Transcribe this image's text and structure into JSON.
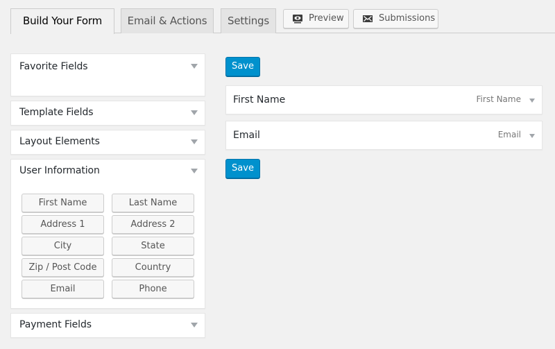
{
  "tabs": [
    {
      "label": "Build Your Form",
      "active": true
    },
    {
      "label": "Email & Actions",
      "active": false
    },
    {
      "label": "Settings",
      "active": false
    }
  ],
  "header_buttons": {
    "preview": {
      "label": "Preview",
      "icon": "preview-icon"
    },
    "submissions": {
      "label": "Submissions",
      "icon": "envelope-icon"
    }
  },
  "sidebar": {
    "panels": [
      {
        "title": "Favorite Fields",
        "expanded": false
      },
      {
        "title": "Template Fields",
        "expanded": false
      },
      {
        "title": "Layout Elements",
        "expanded": false
      },
      {
        "title": "User Information",
        "expanded": true,
        "fields": [
          "First Name",
          "Last Name",
          "Address 1",
          "Address 2",
          "City",
          "State",
          "Zip / Post Code",
          "Country",
          "Email",
          "Phone"
        ]
      },
      {
        "title": "Payment Fields",
        "expanded": false
      }
    ]
  },
  "form": {
    "save_label": "Save",
    "fields": [
      {
        "label": "First Name",
        "type": "First Name"
      },
      {
        "label": "Email",
        "type": "Email"
      }
    ]
  },
  "colors": {
    "background": "#f1f1f1",
    "save_button": "#0091cd",
    "panel": "#ffffff"
  }
}
